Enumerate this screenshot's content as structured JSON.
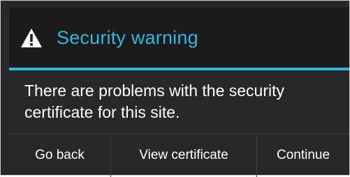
{
  "dialog": {
    "title": "Security warning",
    "icon": "warning-icon",
    "message": "There are problems with the security certificate for this site.",
    "accent_color": "#33b5e5",
    "buttons": {
      "go_back": "Go back",
      "view_certificate": "View certificate",
      "continue": "Continue"
    }
  }
}
